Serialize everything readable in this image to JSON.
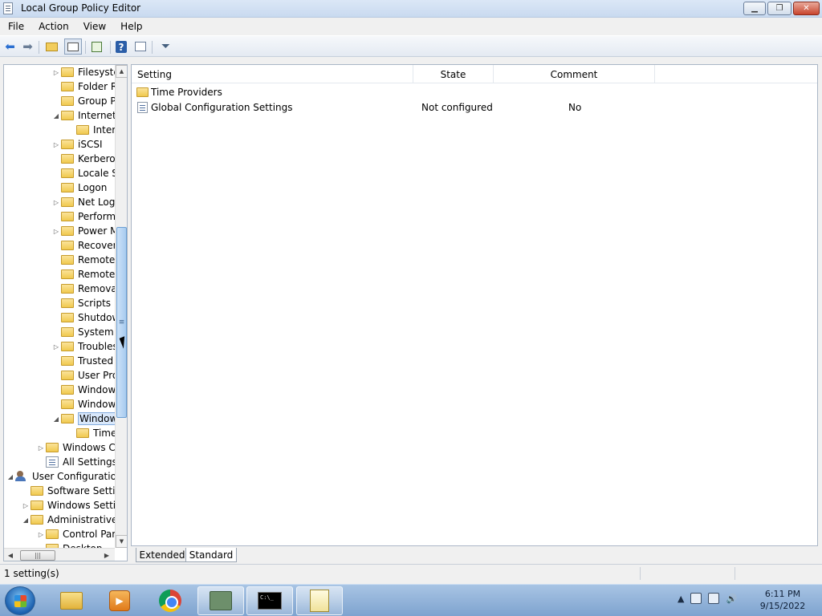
{
  "window": {
    "title": "Local Group Policy Editor",
    "min_label": "▭",
    "max_label": "❐",
    "close_label": "✕"
  },
  "menu": [
    "File",
    "Action",
    "View",
    "Help"
  ],
  "toolbar": {
    "icons": [
      "back-icon",
      "forward-icon",
      "up-folder-icon",
      "show-hide-tree-icon",
      "export-list-icon",
      "help-icon",
      "properties-icon",
      "filter-icon"
    ]
  },
  "tree": {
    "items": [
      {
        "label": "Filesyste",
        "indent": 3,
        "toggle": "▷",
        "icon": "folder"
      },
      {
        "label": "Folder R",
        "indent": 3,
        "toggle": "",
        "icon": "folder"
      },
      {
        "label": "Group P",
        "indent": 3,
        "toggle": "",
        "icon": "folder"
      },
      {
        "label": "Internet",
        "indent": 3,
        "toggle": "◢",
        "icon": "folder"
      },
      {
        "label": "Inter",
        "indent": 4,
        "toggle": "",
        "icon": "folder"
      },
      {
        "label": "iSCSI",
        "indent": 3,
        "toggle": "▷",
        "icon": "folder"
      },
      {
        "label": "Kerberos",
        "indent": 3,
        "toggle": "",
        "icon": "folder"
      },
      {
        "label": "Locale S",
        "indent": 3,
        "toggle": "",
        "icon": "folder"
      },
      {
        "label": "Logon",
        "indent": 3,
        "toggle": "",
        "icon": "folder"
      },
      {
        "label": "Net Logo",
        "indent": 3,
        "toggle": "▷",
        "icon": "folder"
      },
      {
        "label": "Perform",
        "indent": 3,
        "toggle": "",
        "icon": "folder"
      },
      {
        "label": "Power M",
        "indent": 3,
        "toggle": "▷",
        "icon": "folder"
      },
      {
        "label": "Recover",
        "indent": 3,
        "toggle": "",
        "icon": "folder"
      },
      {
        "label": "Remote",
        "indent": 3,
        "toggle": "",
        "icon": "folder"
      },
      {
        "label": "Remote",
        "indent": 3,
        "toggle": "",
        "icon": "folder"
      },
      {
        "label": "Remova",
        "indent": 3,
        "toggle": "",
        "icon": "folder"
      },
      {
        "label": "Scripts",
        "indent": 3,
        "toggle": "",
        "icon": "folder"
      },
      {
        "label": "Shutdow",
        "indent": 3,
        "toggle": "",
        "icon": "folder"
      },
      {
        "label": "System R",
        "indent": 3,
        "toggle": "",
        "icon": "folder"
      },
      {
        "label": "Troubles",
        "indent": 3,
        "toggle": "▷",
        "icon": "folder"
      },
      {
        "label": "Trusted",
        "indent": 3,
        "toggle": "",
        "icon": "folder"
      },
      {
        "label": "User Pro",
        "indent": 3,
        "toggle": "",
        "icon": "folder"
      },
      {
        "label": "Window",
        "indent": 3,
        "toggle": "",
        "icon": "folder"
      },
      {
        "label": "Window",
        "indent": 3,
        "toggle": "",
        "icon": "folder"
      },
      {
        "label": "Window",
        "indent": 3,
        "toggle": "◢",
        "icon": "folder",
        "selected": true
      },
      {
        "label": "Time",
        "indent": 4,
        "toggle": "",
        "icon": "folder"
      },
      {
        "label": "Windows Co",
        "indent": 2,
        "toggle": "▷",
        "icon": "folder"
      },
      {
        "label": "All Settings",
        "indent": 2,
        "toggle": "",
        "icon": "settings"
      },
      {
        "label": "User Configuration",
        "indent": 0,
        "toggle": "◢",
        "icon": "user"
      },
      {
        "label": "Software Setting",
        "indent": 1,
        "toggle": "",
        "icon": "folder"
      },
      {
        "label": "Windows Settin",
        "indent": 1,
        "toggle": "▷",
        "icon": "folder"
      },
      {
        "label": "Administrative T",
        "indent": 1,
        "toggle": "◢",
        "icon": "folder"
      },
      {
        "label": "Control Pan",
        "indent": 2,
        "toggle": "▷",
        "icon": "folder"
      },
      {
        "label": "Desktop",
        "indent": 2,
        "toggle": "",
        "icon": "folder"
      }
    ]
  },
  "list": {
    "columns": [
      "Setting",
      "State",
      "Comment"
    ],
    "rows": [
      {
        "type": "folder",
        "name": "Time Providers",
        "state": "",
        "comment": ""
      },
      {
        "type": "setting",
        "name": "Global Configuration Settings",
        "state": "Not configured",
        "comment": "No"
      }
    ]
  },
  "tabs": {
    "extended": "Extended",
    "standard": "Standard"
  },
  "status": {
    "text": "1 setting(s)"
  },
  "taskbar": {
    "apps": [
      "windows-explorer-icon",
      "media-player-icon",
      "chrome-icon",
      "group-policy-icon",
      "cmd-icon",
      "notepad-icon"
    ],
    "tray_arrow": "▲",
    "time": "6:11 PM",
    "date": "9/15/2022"
  }
}
